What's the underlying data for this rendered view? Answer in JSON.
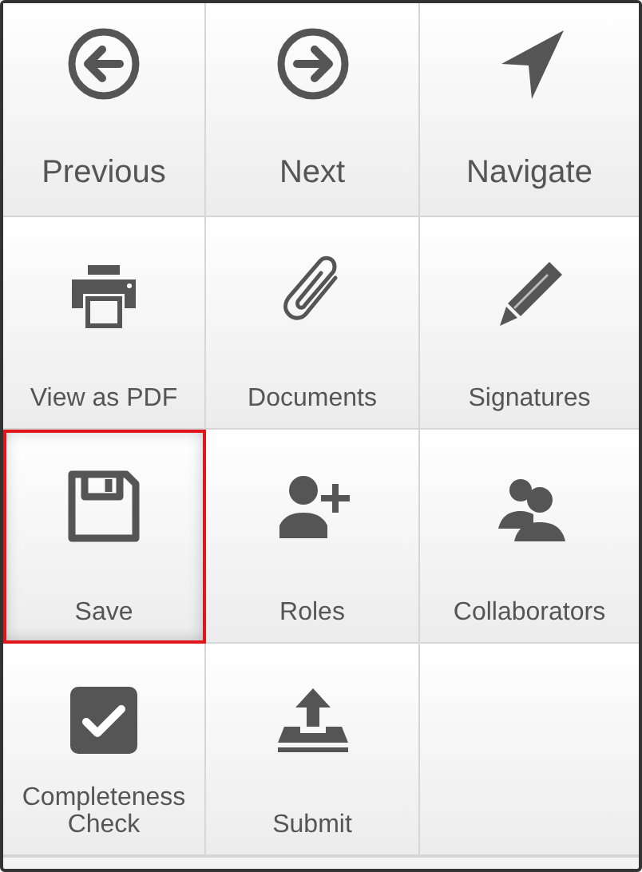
{
  "rows": [
    {
      "kind": "large",
      "buttons": [
        {
          "label": "Previous",
          "selected": false
        },
        {
          "label": "Next",
          "selected": false
        },
        {
          "label": "Navigate",
          "selected": false
        }
      ]
    },
    {
      "kind": "compact",
      "buttons": [
        {
          "label": "View as PDF",
          "selected": false
        },
        {
          "label": "Documents",
          "selected": false
        },
        {
          "label": "Signatures",
          "selected": false
        }
      ]
    },
    {
      "kind": "compact",
      "buttons": [
        {
          "label": "Save",
          "selected": true
        },
        {
          "label": "Roles",
          "selected": false
        },
        {
          "label": "Collaborators",
          "selected": false
        }
      ]
    },
    {
      "kind": "compact",
      "buttons": [
        {
          "label": "Completeness Check",
          "selected": false
        },
        {
          "label": "Submit",
          "selected": false
        }
      ]
    }
  ]
}
